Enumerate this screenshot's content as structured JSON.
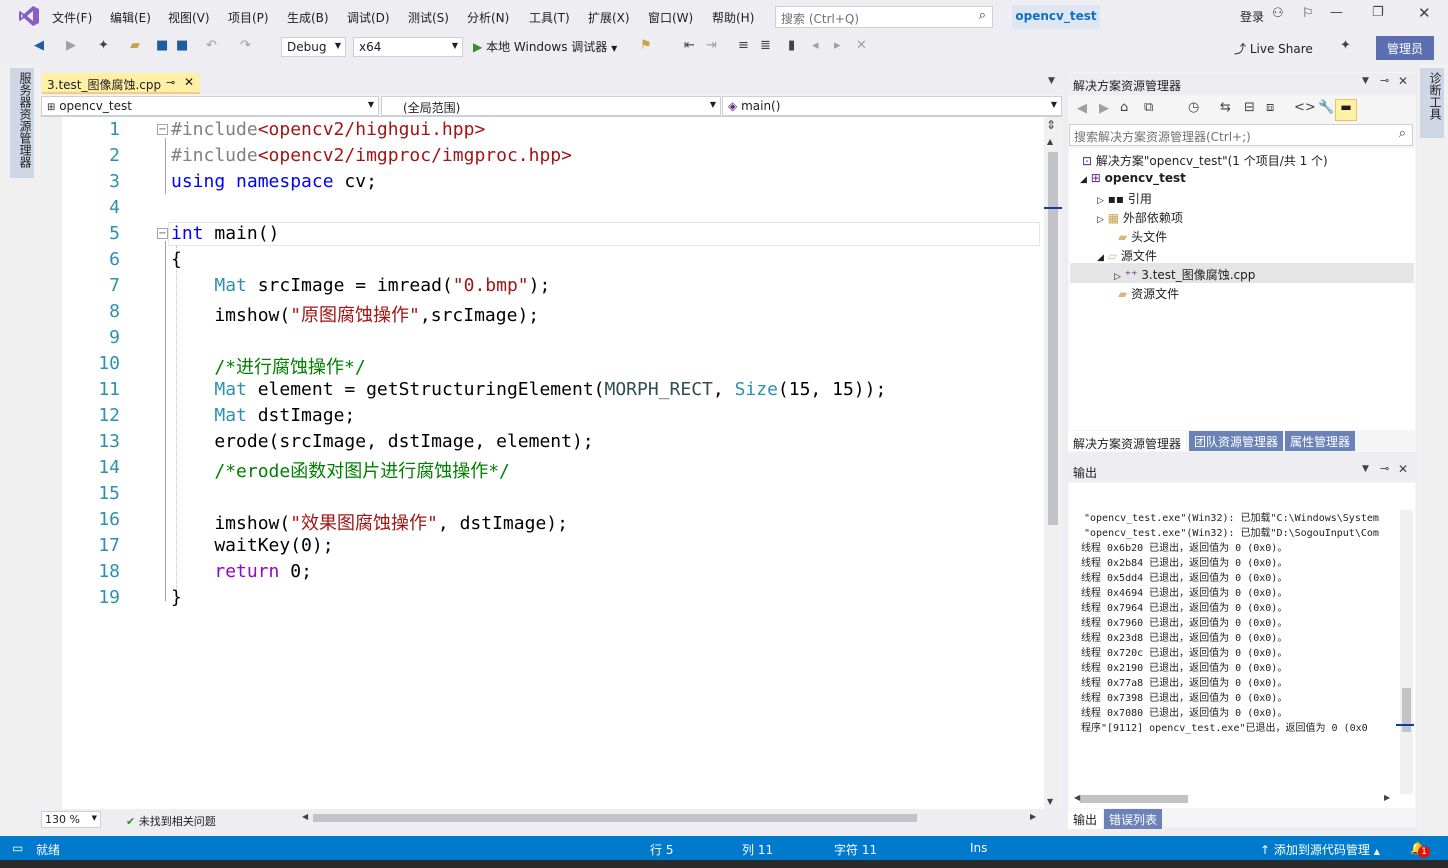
{
  "menu": [
    "文件(F)",
    "编辑(E)",
    "视图(V)",
    "项目(P)",
    "生成(B)",
    "调试(D)",
    "测试(S)",
    "分析(N)",
    "工具(T)",
    "扩展(X)",
    "窗口(W)",
    "帮助(H)"
  ],
  "search_placeholder": "搜索 (Ctrl+Q)",
  "project_badge": "opencv_test",
  "login": "登录",
  "toolbar": {
    "config": "Debug",
    "platform": "x64",
    "run_label": "本地 Windows 调试器",
    "liveshare": "Live Share",
    "admin": "管理员"
  },
  "left_strip": "服务器资源管理器",
  "right_strip": "诊断工具",
  "editor": {
    "tab": "3.test_图像腐蚀.cpp",
    "nav_project": "opencv_test",
    "nav_scope": "(全局范围)",
    "nav_member": "main()",
    "lines": [
      {
        "n": "1",
        "html": "<span style='color:#808080'>#include</span><span style='color:#a31515'>&lt;opencv2/highgui.hpp&gt;</span>"
      },
      {
        "n": "2",
        "html": "<span style='color:#808080'>#include</span><span style='color:#a31515'>&lt;opencv2/imgproc/imgproc.hpp&gt;</span>"
      },
      {
        "n": "3",
        "html": "<span style='color:#0000ff'>using</span> <span style='color:#0000ff'>namespace</span> cv;"
      },
      {
        "n": "4",
        "html": ""
      },
      {
        "n": "5",
        "html": "<span style='color:#0000ff'>int</span> main()"
      },
      {
        "n": "6",
        "html": "{"
      },
      {
        "n": "7",
        "html": "    <span style='color:#2b91af'>Mat</span> srcImage = imread(<span style='color:#a31515'>\"0.bmp\"</span>);"
      },
      {
        "n": "8",
        "html": "    imshow(<span style='color:#a31515'>\"原图腐蚀操作\"</span>,srcImage);"
      },
      {
        "n": "9",
        "html": ""
      },
      {
        "n": "10",
        "html": "    <span style='color:#008000'>/*进行腐蚀操作*/</span>"
      },
      {
        "n": "11",
        "html": "    <span style='color:#2b91af'>Mat</span> element = getStructuringElement(<span style='color:#2f4f4f'>MORPH_RECT</span>, <span style='color:#2b91af'>Size</span>(15, 15));"
      },
      {
        "n": "12",
        "html": "    <span style='color:#2b91af'>Mat</span> dstImage;"
      },
      {
        "n": "13",
        "html": "    erode(srcImage, dstImage, element);"
      },
      {
        "n": "14",
        "html": "    <span style='color:#008000'>/*erode函数对图片进行腐蚀操作*/</span>"
      },
      {
        "n": "15",
        "html": ""
      },
      {
        "n": "16",
        "html": "    imshow(<span style='color:#a31515'>\"效果图腐蚀操作\"</span>, dstImage);"
      },
      {
        "n": "17",
        "html": "    waitKey(0);"
      },
      {
        "n": "18",
        "html": "    <span style='color:#8f08c4'>return</span> 0;"
      },
      {
        "n": "19",
        "html": "}"
      }
    ],
    "zoom": "130 %",
    "issues": "未找到相关问题"
  },
  "solution": {
    "title": "解决方案资源管理器",
    "search_placeholder": "搜索解决方案资源管理器(Ctrl+;)",
    "root": "解决方案\"opencv_test\"(1 个项目/共 1 个)",
    "project": "opencv_test",
    "nodes": [
      "引用",
      "外部依赖项",
      "头文件",
      "源文件",
      "3.test_图像腐蚀.cpp",
      "资源文件"
    ],
    "bottom_tabs": [
      "解决方案资源管理器",
      "团队资源管理器",
      "属性管理器"
    ]
  },
  "output": {
    "title": "输出",
    "lines": [
      "\"opencv_test.exe\"(Win32): 已加载\"C:\\Windows\\System",
      "\"opencv_test.exe\"(Win32): 已加载\"D:\\SogouInput\\Com",
      "线程 0x6b20 已退出，返回值为 0 (0x0)。",
      "线程 0x2b84 已退出，返回值为 0 (0x0)。",
      "线程 0x5dd4 已退出，返回值为 0 (0x0)。",
      "线程 0x4694 已退出，返回值为 0 (0x0)。",
      "线程 0x7964 已退出，返回值为 0 (0x0)。",
      "线程 0x7960 已退出，返回值为 0 (0x0)。",
      "线程 0x23d8 已退出，返回值为 0 (0x0)。",
      "线程 0x720c 已退出，返回值为 0 (0x0)。",
      "线程 0x2190 已退出，返回值为 0 (0x0)。",
      "线程 0x77a8 已退出，返回值为 0 (0x0)。",
      "线程 0x7398 已退出，返回值为 0 (0x0)。",
      "线程 0x7080 已退出，返回值为 0 (0x0)。",
      "程序\"[9112] opencv_test.exe\"已退出，返回值为 0 (0x0"
    ],
    "bottom_tabs": [
      "输出",
      "错误列表"
    ]
  },
  "status": {
    "ready": "就绪",
    "row": "行 5",
    "col": "列 11",
    "char": "字符 11",
    "ins": "Ins",
    "source_control": "添加到源代码管理",
    "notif_count": "1"
  }
}
